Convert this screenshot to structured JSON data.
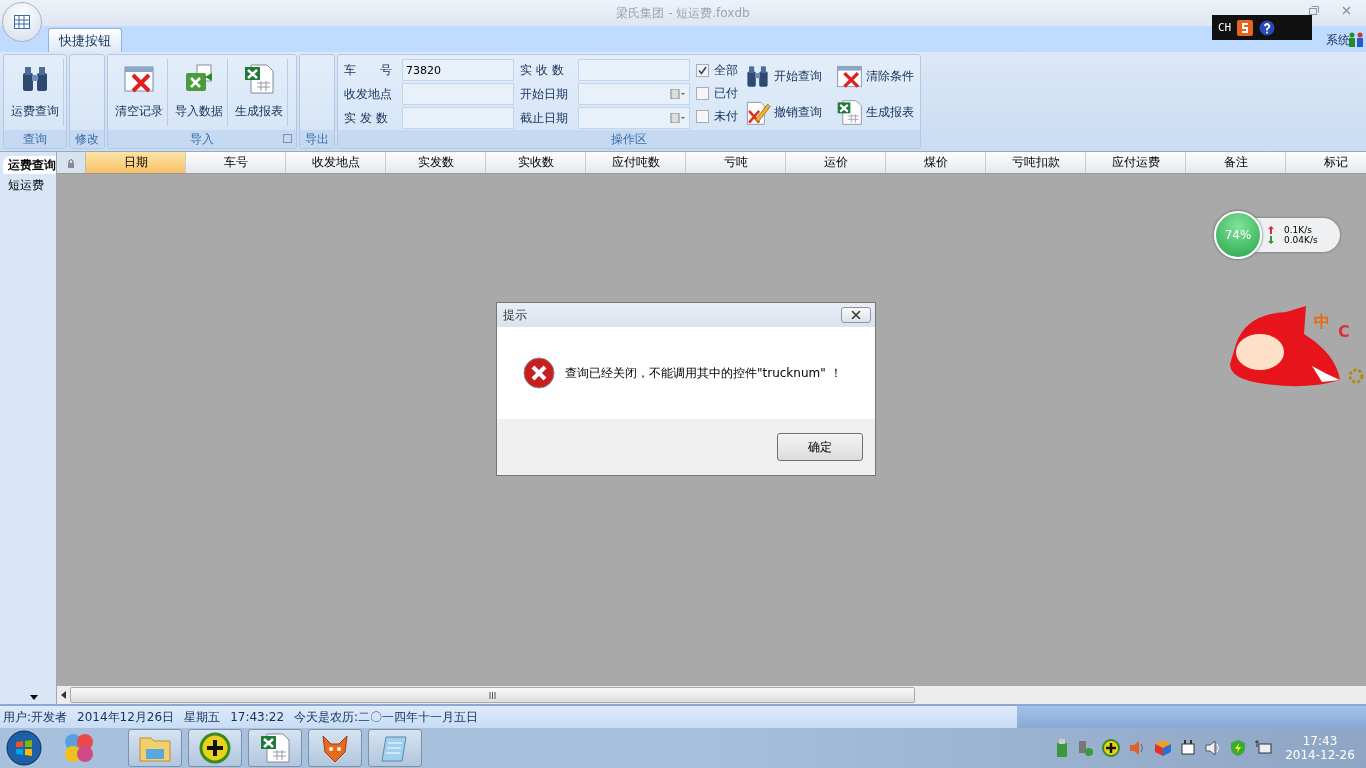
{
  "window": {
    "title": "梁氏集团 - 短运费.foxdb"
  },
  "ime_bar": {
    "label": "CH"
  },
  "exit_link": {
    "label": "系统"
  },
  "ribbon_tabs": [
    {
      "label": "快捷按钮",
      "selected": true
    }
  ],
  "ribbon_groups": [
    {
      "title": "查询",
      "buttons": [
        {
          "label": "运费查询",
          "kind": "binoculars"
        }
      ]
    },
    {
      "title": "修改"
    },
    {
      "title": "导入",
      "launcher": true,
      "buttons": [
        {
          "label": "清空记录",
          "kind": "clear"
        },
        {
          "label": "导入数据",
          "kind": "import"
        },
        {
          "label": "生成报表",
          "kind": "excel"
        }
      ]
    },
    {
      "title": "导出"
    }
  ],
  "query_panel": {
    "title": "操作区",
    "fields": [
      {
        "label": "车　　号",
        "kind": "text",
        "value": "73820"
      },
      {
        "label": "收发地点",
        "kind": "text"
      },
      {
        "label": "实 发 数",
        "kind": "text"
      },
      {
        "label": "实 收 数",
        "kind": "text"
      },
      {
        "label": "开始日期",
        "kind": "date"
      },
      {
        "label": "截止日期",
        "kind": "date"
      }
    ],
    "checkboxes": [
      {
        "label": "全部",
        "checked": true
      },
      {
        "label": "已付",
        "checked": false
      },
      {
        "label": "未付",
        "checked": false
      }
    ],
    "actions": [
      {
        "label": "开始查询",
        "kind": "binoculars"
      },
      {
        "label": "撤销查询",
        "kind": "pencil"
      },
      {
        "label": "清除条件",
        "kind": "clear"
      },
      {
        "label": "生成报表",
        "kind": "excel"
      }
    ]
  },
  "sidebar": {
    "items": [
      {
        "label": "运费查询",
        "selected": true
      },
      {
        "label": "短运费",
        "selected": false
      }
    ]
  },
  "grid": {
    "columns": [
      {
        "label": "日期",
        "selected": true
      },
      {
        "label": "车号",
        "selected": false
      },
      {
        "label": "收发地点",
        "selected": false
      },
      {
        "label": "实发数",
        "selected": false
      },
      {
        "label": "实收数",
        "selected": false
      },
      {
        "label": "应付吨数",
        "selected": false
      },
      {
        "label": "亏吨",
        "selected": false
      },
      {
        "label": "运价",
        "selected": false
      },
      {
        "label": "煤价",
        "selected": false
      },
      {
        "label": "亏吨扣款",
        "selected": false
      },
      {
        "label": "应付运费",
        "selected": false
      },
      {
        "label": "备注",
        "selected": false
      },
      {
        "label": "标记",
        "selected": false
      }
    ]
  },
  "net_widget": {
    "percent": "74%",
    "up": "0.1K/s",
    "down": "0.04K/s"
  },
  "mascot": {
    "labels": [
      "中",
      "C"
    ]
  },
  "dialog": {
    "title": "提示",
    "message": "查询已经关闭，不能调用其中的控件\"trucknum\" ！",
    "button": "确定"
  },
  "status_bar": {
    "segments": [
      "用户:开发者",
      "2014年12月26日",
      "星期五",
      "17:43:22",
      "今天是农历:二〇一四年十一月五日"
    ]
  },
  "taskbar": {
    "apps": [
      {
        "kind": "folder"
      },
      {
        "kind": "plus"
      },
      {
        "kind": "excel"
      },
      {
        "kind": "fox"
      },
      {
        "kind": "notepad"
      }
    ],
    "time": "17:43",
    "date": "2014-12-26"
  }
}
